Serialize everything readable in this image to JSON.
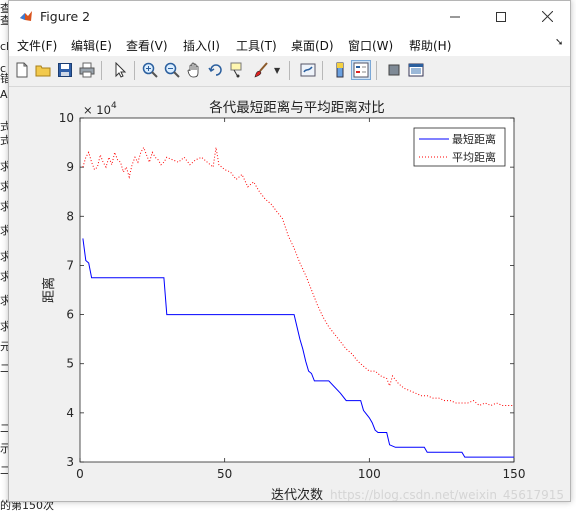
{
  "background_window": {
    "fragments": [
      "查",
      "查",
      "cl",
      "c",
      "错",
      "AC",
      "式",
      "式",
      "求",
      "求",
      "求",
      "求",
      "求",
      "求",
      "求",
      "求",
      "元",
      "二",
      "二",
      "示",
      "二"
    ],
    "console_line": "的第150次"
  },
  "window": {
    "title": "Figure 2",
    "minimize_icon": "minimize-icon",
    "maximize_icon": "maximize-icon",
    "close_icon": "close-icon"
  },
  "menubar": {
    "items": [
      "文件(F)",
      "编辑(E)",
      "查看(V)",
      "插入(I)",
      "工具(T)",
      "桌面(D)",
      "窗口(W)",
      "帮助(H)"
    ]
  },
  "toolbar": {
    "icons": [
      "new-figure-icon",
      "open-file-icon",
      "save-icon",
      "print-icon",
      "pointer-icon",
      "zoom-in-icon",
      "zoom-out-icon",
      "pan-icon",
      "rotate-3d-icon",
      "data-cursor-icon",
      "brush-icon",
      "link-plot-icon",
      "colorbar-icon",
      "legend-icon",
      "hide-plot-tools-icon",
      "show-plot-tools-icon"
    ]
  },
  "chart_data": {
    "type": "line",
    "title": "各代最短距离与平均距离对比",
    "xlabel": "迭代次数",
    "ylabel": "距离",
    "xlim": [
      0,
      150
    ],
    "ylim": [
      3,
      10
    ],
    "y_multiplier": "× 10^4",
    "y_multiplier_base": "× 10",
    "y_multiplier_exp": "4",
    "x_ticks": [
      0,
      50,
      100,
      150
    ],
    "x_tick_labels": [
      "0",
      "50",
      "100",
      "150"
    ],
    "y_ticks": [
      3,
      4,
      5,
      6,
      7,
      8,
      9,
      10
    ],
    "y_tick_labels": [
      "3",
      "4",
      "5",
      "6",
      "7",
      "8",
      "9",
      "10"
    ],
    "grid": false,
    "legend_position": "top-right",
    "series": [
      {
        "name": "最短距离",
        "color": "#0000ff",
        "style": "solid",
        "x": [
          1,
          2,
          3,
          4,
          29,
          30,
          74,
          75,
          76,
          77,
          78,
          79,
          80,
          81,
          82,
          84,
          86,
          90,
          92,
          97,
          98,
          100,
          101,
          102,
          103,
          106,
          107,
          109,
          119,
          120,
          132,
          133,
          150
        ],
        "y": [
          7.55,
          7.1,
          7.05,
          6.75,
          6.75,
          6.0,
          6.0,
          5.75,
          5.5,
          5.3,
          5.05,
          4.85,
          4.8,
          4.65,
          4.65,
          4.65,
          4.65,
          4.4,
          4.25,
          4.25,
          4.05,
          3.9,
          3.8,
          3.65,
          3.6,
          3.6,
          3.35,
          3.3,
          3.3,
          3.2,
          3.2,
          3.1,
          3.1
        ]
      },
      {
        "name": "平均距离",
        "color": "#ff0000",
        "style": "dotted",
        "x": [
          1,
          2,
          3,
          4,
          5,
          6,
          7,
          8,
          9,
          10,
          11,
          12,
          13,
          14,
          15,
          16,
          17,
          18,
          19,
          20,
          21,
          22,
          23,
          24,
          25,
          26,
          27,
          28,
          29,
          30,
          32,
          34,
          36,
          38,
          40,
          42,
          44,
          46,
          47,
          48,
          50,
          52,
          54,
          56,
          58,
          60,
          62,
          64,
          66,
          68,
          70,
          72,
          74,
          76,
          78,
          80,
          82,
          84,
          86,
          88,
          90,
          92,
          94,
          96,
          98,
          100,
          102,
          104,
          106,
          107,
          108,
          110,
          112,
          114,
          116,
          118,
          120,
          122,
          124,
          126,
          128,
          130,
          132,
          134,
          136,
          138,
          140,
          142,
          144,
          146,
          148,
          150
        ],
        "y": [
          9.0,
          9.2,
          9.3,
          9.1,
          8.95,
          9.0,
          9.25,
          9.1,
          9.0,
          9.2,
          9.05,
          9.3,
          9.15,
          9.1,
          8.9,
          9.0,
          8.8,
          9.05,
          9.2,
          9.1,
          9.3,
          9.4,
          9.25,
          9.1,
          9.3,
          9.2,
          9.15,
          9.05,
          9.1,
          9.2,
          9.15,
          9.1,
          9.2,
          9.05,
          9.15,
          9.2,
          9.1,
          9.0,
          9.4,
          9.05,
          8.95,
          8.9,
          8.75,
          8.85,
          8.6,
          8.7,
          8.5,
          8.35,
          8.25,
          8.1,
          7.95,
          7.6,
          7.35,
          7.05,
          6.8,
          6.5,
          6.2,
          5.95,
          5.75,
          5.6,
          5.45,
          5.3,
          5.2,
          5.05,
          4.95,
          4.85,
          4.85,
          4.75,
          4.7,
          4.55,
          4.75,
          4.6,
          4.5,
          4.45,
          4.4,
          4.35,
          4.35,
          4.3,
          4.3,
          4.25,
          4.25,
          4.2,
          4.2,
          4.2,
          4.25,
          4.15,
          4.2,
          4.15,
          4.2,
          4.15,
          4.15,
          4.15
        ]
      }
    ]
  },
  "watermark": "https://blog.csdn.net/weixin_45617915"
}
